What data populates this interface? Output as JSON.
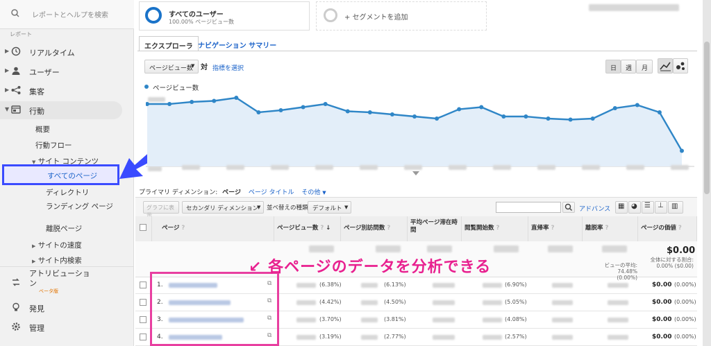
{
  "sidebar": {
    "search_placeholder": "レポートとヘルプを検索",
    "section_label": "レポート",
    "nav": [
      {
        "label": "リアルタイム"
      },
      {
        "label": "ユーザー"
      },
      {
        "label": "集客"
      },
      {
        "label": "行動"
      }
    ],
    "behavior_sub": [
      "概要",
      "行動フロー"
    ],
    "site_content_label": "サイト コンテンツ",
    "site_content_items": [
      "すべてのページ",
      "ディレクトリ",
      "ランディング ページ",
      "離脱ページ"
    ],
    "site_speed": "サイトの速度",
    "site_search": "サイト内検索",
    "attribution_label": "アトリビューション",
    "attribution_badge": "ベータ版",
    "discover": "発見",
    "admin": "管理"
  },
  "segments": {
    "active_name": "すべてのユーザー",
    "active_sub": "100.00% ページビュー数",
    "add_label": "+ セグメントを追加"
  },
  "tabs": [
    "エクスプローラ",
    "ナビゲーション サマリー"
  ],
  "controls": {
    "metric_select": "ページビュー数",
    "vs": "対",
    "pick_metric": "指標を選択",
    "period_buttons": [
      "日",
      "週",
      "月"
    ]
  },
  "chart_data": {
    "type": "line",
    "series": [
      {
        "name": "ページビュー数",
        "values": [
          60,
          60,
          62,
          63,
          66,
          52,
          54,
          57,
          60,
          53,
          52,
          50,
          48,
          46,
          55,
          57,
          48,
          48,
          46,
          45,
          46,
          56,
          59,
          52,
          15
        ]
      }
    ],
    "color": "#2f86c7"
  },
  "dimension": {
    "label": "プライマリ ディメンション:",
    "current": "ページ",
    "alt": "ページ タイトル",
    "other": "その他"
  },
  "table_toolbar": {
    "graph_btn": "グラフに表示",
    "secondary_dim": "セカンダリ ディメンション",
    "sort_label": "並べ替えの種類:",
    "sort_value": "デフォルト",
    "advanced": "アドバンス"
  },
  "table": {
    "headers": [
      "ページ",
      "ページビュー数",
      "ページ別訪問数",
      "平均ページ滞在時間",
      "閲覧開始数",
      "直帰率",
      "離脱率",
      "ページの価値"
    ],
    "summary_value": "$0.00",
    "summary_value_sub": "全体に対する割合: 0.00% ($0.00)",
    "summary_exit_sub": "ビューの平均: 74.48% (0.00%)",
    "rows": [
      {
        "num": "1.",
        "pv_pct": "(6.38%)",
        "upv_pct": "(6.13%)",
        "ent_pct": "(6.90%)",
        "value": "$0.00",
        "value_pct": "(0.00%)"
      },
      {
        "num": "2.",
        "pv_pct": "(4.42%)",
        "upv_pct": "(4.50%)",
        "ent_pct": "(5.05%)",
        "value": "$0.00",
        "value_pct": "(0.00%)"
      },
      {
        "num": "3.",
        "pv_pct": "(3.70%)",
        "upv_pct": "(3.81%)",
        "ent_pct": "(4.08%)",
        "value": "$0.00",
        "value_pct": "(0.00%)"
      },
      {
        "num": "4.",
        "pv_pct": "(3.19%)",
        "upv_pct": "(2.77%)",
        "ent_pct": "(2.57%)",
        "value": "$0.00",
        "value_pct": "(0.00%)"
      }
    ]
  },
  "annotation": "↙ 各ページのデータを分析できる"
}
